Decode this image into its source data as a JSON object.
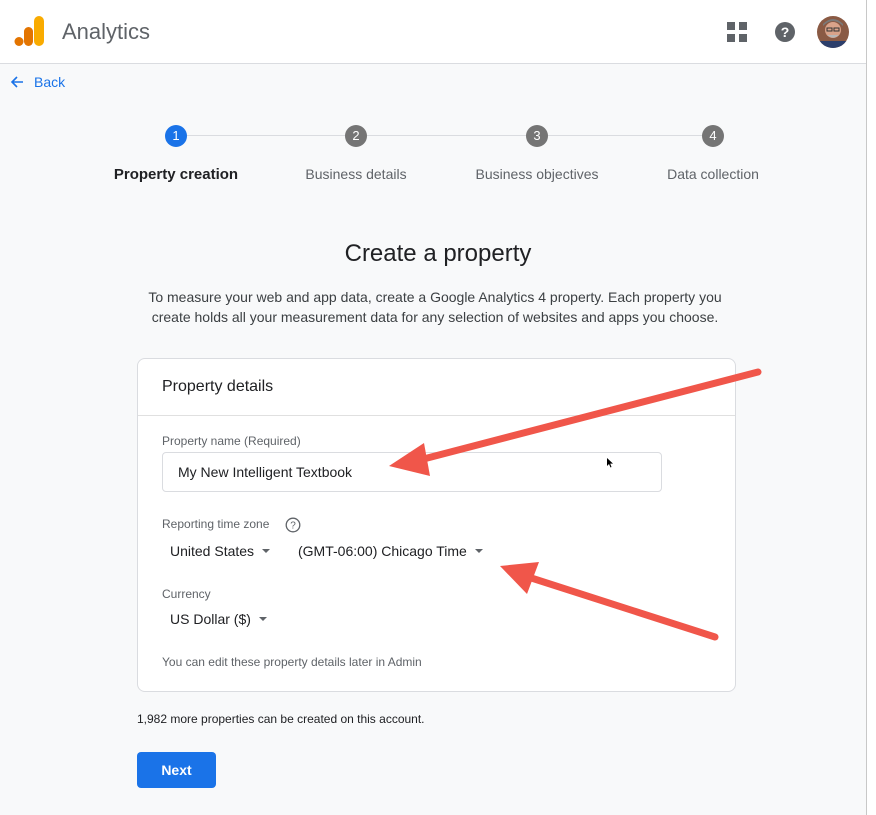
{
  "header": {
    "app_title": "Analytics",
    "icons": [
      "analytics-logo-icon",
      "apps-grid-icon",
      "help-icon",
      "avatar"
    ]
  },
  "nav": {
    "back_label": "Back"
  },
  "stepper": {
    "steps": [
      {
        "number": "1",
        "label": "Property creation",
        "state": "active"
      },
      {
        "number": "2",
        "label": "Business details",
        "state": "inactive"
      },
      {
        "number": "3",
        "label": "Business objectives",
        "state": "inactive"
      },
      {
        "number": "4",
        "label": "Data collection",
        "state": "inactive"
      }
    ]
  },
  "main": {
    "heading": "Create a property",
    "description_line1": "To measure your web and app data, create a Google Analytics 4 property. Each property you",
    "description_line2": "create holds all your measurement data for any selection of websites and apps you choose."
  },
  "card": {
    "title": "Property details",
    "property_name_label": "Property name (Required)",
    "property_name_value": "My New Intelligent Textbook",
    "timezone_label": "Reporting time zone",
    "country_value": "United States",
    "timezone_value": "(GMT-06:00) Chicago Time",
    "currency_label": "Currency",
    "currency_value": "US Dollar ($)",
    "edit_note": "You can edit these property details later in Admin"
  },
  "footer": {
    "properties_note": "1,982 more properties can be created on this account.",
    "next_label": "Next"
  },
  "colors": {
    "accent": "#1a73e8",
    "step_inactive": "#757575",
    "annotation_arrow": "#f0564a",
    "logo_orange": "#f9ab00",
    "logo_dark_orange": "#e37400"
  }
}
